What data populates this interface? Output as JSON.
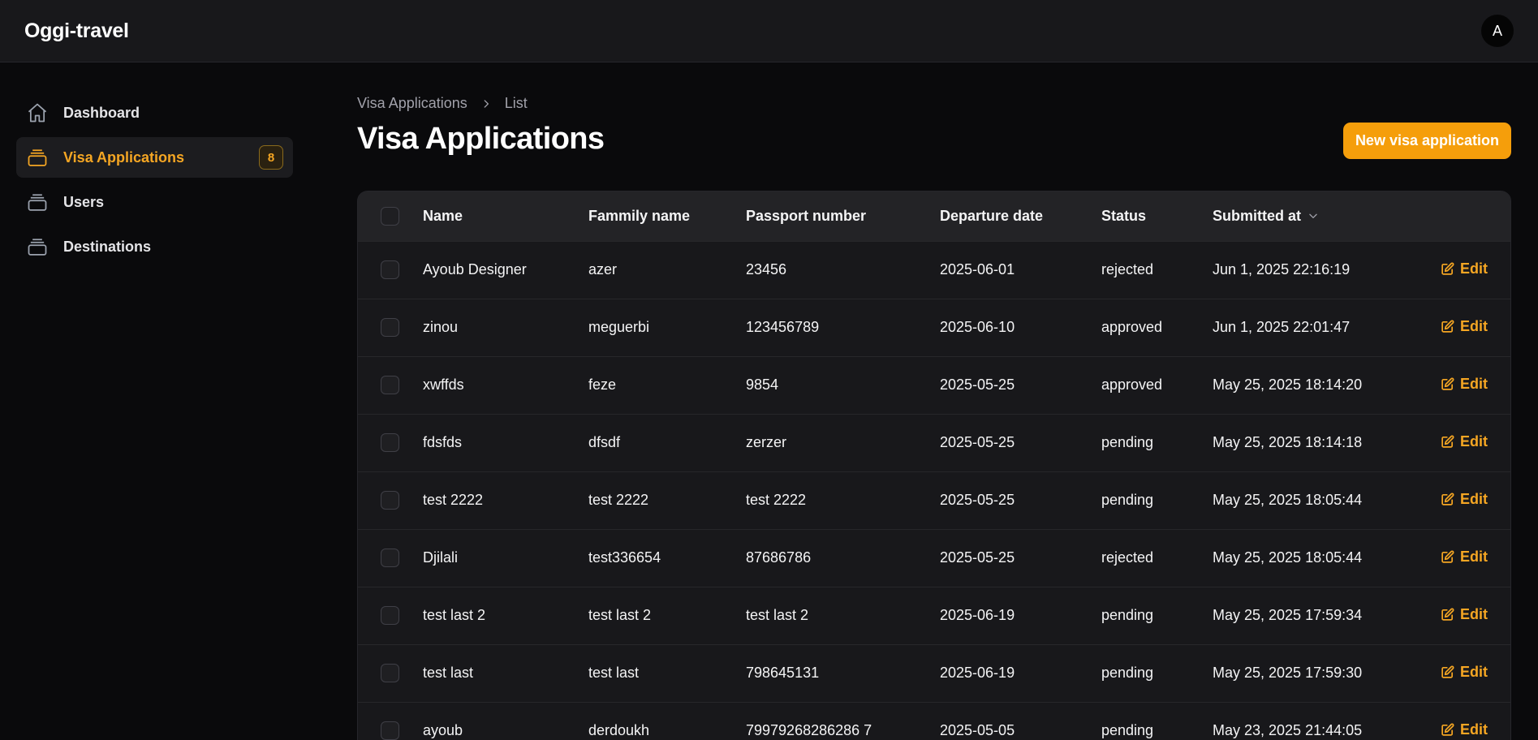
{
  "app": {
    "brand": "Oggi-travel",
    "avatar_initial": "A"
  },
  "sidebar": {
    "items": [
      {
        "label": "Dashboard",
        "icon": "home-icon",
        "active": false
      },
      {
        "label": "Visa Applications",
        "icon": "stack-icon",
        "active": true,
        "badge": "8"
      },
      {
        "label": "Users",
        "icon": "stack-icon",
        "active": false
      },
      {
        "label": "Destinations",
        "icon": "stack-icon",
        "active": false
      }
    ]
  },
  "breadcrumb": {
    "parent": "Visa Applications",
    "current": "List"
  },
  "page": {
    "title": "Visa Applications",
    "new_button_label": "New visa application"
  },
  "table": {
    "columns": [
      "Name",
      "Fammily name",
      "Passport number",
      "Departure date",
      "Status",
      "Submitted at"
    ],
    "action_label": "Edit",
    "rows": [
      [
        "Ayoub Designer",
        "azer",
        "23456",
        "2025-06-01",
        "rejected",
        "Jun 1, 2025 22:16:19"
      ],
      [
        "zinou",
        "meguerbi",
        "123456789",
        "2025-06-10",
        "approved",
        "Jun 1, 2025 22:01:47"
      ],
      [
        "xwffds",
        "feze",
        "9854",
        "2025-05-25",
        "approved",
        "May 25, 2025 18:14:20"
      ],
      [
        "fdsfds",
        "dfsdf",
        "zerzer",
        "2025-05-25",
        "pending",
        "May 25, 2025 18:14:18"
      ],
      [
        "test 2222",
        "test 2222",
        "test 2222",
        "2025-05-25",
        "pending",
        "May 25, 2025 18:05:44"
      ],
      [
        "Djilali",
        "test336654",
        "87686786",
        "2025-05-25",
        "rejected",
        "May 25, 2025 18:05:44"
      ],
      [
        "test last 2",
        "test last 2",
        "test last 2",
        "2025-06-19",
        "pending",
        "May 25, 2025 17:59:34"
      ],
      [
        "test last",
        "test last",
        "798645131",
        "2025-06-19",
        "pending",
        "May 25, 2025 17:59:30"
      ],
      [
        "ayoub",
        "derdoukh",
        "79979268286286 7",
        "2025-05-05",
        "pending",
        "May 23, 2025 21:44:05"
      ]
    ]
  },
  "colors": {
    "accent": "#f59e0b",
    "background": "#0a0a0c",
    "surface": "#18181b"
  }
}
